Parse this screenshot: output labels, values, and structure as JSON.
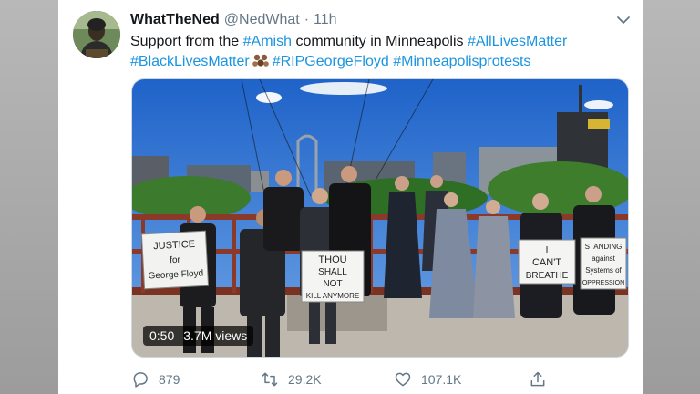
{
  "tweet": {
    "display_name": "WhatTheNed",
    "handle": "@NedWhat",
    "separator": "·",
    "time": "11h",
    "text_lead": "Support from the",
    "tag_amish": "#Amish",
    "text_mid": "community in Minneapolis",
    "tag_alm": "#AllLivesMatter",
    "tag_blm": "#BlackLivesMatter",
    "tag_rip": "#RIPGeorgeFloyd",
    "tag_mpls": "#Minneapolisprotests"
  },
  "media": {
    "duration": "0:50",
    "views": "3.7M views",
    "signs": {
      "sign1": [
        "JUSTICE",
        "for",
        "George Floyd"
      ],
      "sign2": [
        "THOU",
        "SHALL",
        "NOT",
        "KILL ANYMORE"
      ],
      "sign3": [
        "I",
        "CAN'T",
        "BREATHE"
      ],
      "sign4": [
        "STANDING",
        "against",
        "Systems of",
        "OPPRESSION"
      ]
    }
  },
  "actions": {
    "replies": "879",
    "retweets": "29.2K",
    "likes": "107.1K"
  },
  "icons": {
    "avatar": "avatar",
    "chevron": "chevron-down-icon",
    "reply": "reply-icon",
    "retweet": "retweet-icon",
    "like": "heart-icon",
    "share": "share-icon",
    "emoji": "raised-hands-emoji-icon"
  },
  "colors": {
    "hashtag": "#1b95e0",
    "text": "#14171a",
    "muted": "#657786"
  }
}
